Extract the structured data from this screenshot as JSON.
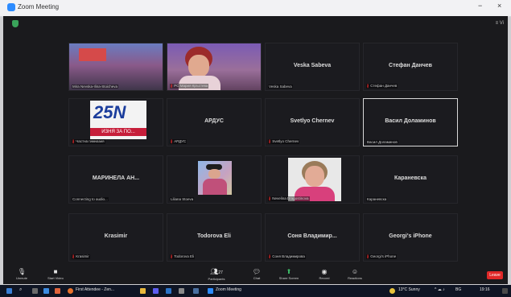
{
  "window": {
    "title": "Zoom Meeting",
    "minimize": "−",
    "close": "×"
  },
  "view_menu": "≡ Vi",
  "tiles": [
    {
      "name": "",
      "label": "Mira Nevska-Ilina-Stoicheva",
      "muted": false
    },
    {
      "name": "",
      "label": "PC Мария Кръстева",
      "muted": true
    },
    {
      "name": "Veska Sabeva",
      "label": "Veska Sabeva",
      "muted": false
    },
    {
      "name": "Стефан Данчев",
      "label": "Стефан Данчев",
      "muted": true
    },
    {
      "name": "",
      "label": "Частна гимназия",
      "muted": true,
      "logo": "25N",
      "logo_sub": "ИЗНЯ ЗА ПО..."
    },
    {
      "name": "АРДУС",
      "label": "АРДУС",
      "muted": true
    },
    {
      "name": "Svetlyo Chernev",
      "label": "Svetlyo Chernev",
      "muted": true
    },
    {
      "name": "Васил Доламинов",
      "label": "Васил Доламинов",
      "muted": false,
      "active": true
    },
    {
      "name": "МАРИНЕЛА АН...",
      "label": "Connecting to audio...",
      "muted": false
    },
    {
      "name": "",
      "label": "Liliana Stoeva",
      "muted": false
    },
    {
      "name": "",
      "label": "Nevelina Dragostinova",
      "muted": true
    },
    {
      "name": "Караневска",
      "label": "Караневска",
      "muted": false
    },
    {
      "name": "Krasimir",
      "label": "Krasimir",
      "muted": true
    },
    {
      "name": "Todorova Eli",
      "label": "Todorova Eli",
      "muted": true
    },
    {
      "name": "Соня  Владимир...",
      "label": "Соня Владимирова",
      "muted": true
    },
    {
      "name": "Georgi's iPhone",
      "label": "Georgi's iPhone",
      "muted": true
    }
  ],
  "toolbar": {
    "unmute": "Unmute",
    "start_video": "Start Video",
    "participants": "Participants",
    "participants_count": "27",
    "chat": "Chat",
    "share_screen": "Share Screen",
    "record": "Record",
    "reactions": "Reactions",
    "leave": "Leave"
  },
  "taskbar": {
    "firefox_label": "First Attendee - Zen...",
    "zoom_label": "Zoom Meeting",
    "weather": "13°C  Sunny",
    "lang": "BG",
    "time": "19:16"
  },
  "colors": {
    "mic_off": "#e02828",
    "zoom_blue": "#2d8cff",
    "leave_red": "#e02828"
  }
}
